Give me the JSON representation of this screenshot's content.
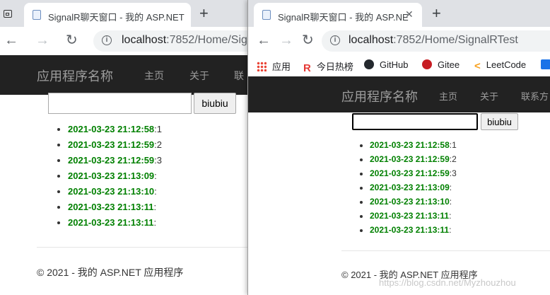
{
  "left": {
    "tab_title": "SignalR聊天窗口 - 我的 ASP.NET",
    "url_host": "localhost",
    "url_path": ":7852/Home/Sig"
  },
  "right": {
    "tab_title": "SignalR聊天窗口 - 我的 ASP.NE",
    "url_host": "localhost",
    "url_path": ":7852/Home/SignalRTest",
    "bookmarks": [
      "应用",
      "今日热榜",
      "GitHub",
      "Gitee",
      "LeetCode"
    ]
  },
  "app": {
    "brand": "应用程序名称",
    "nav_home": "主页",
    "nav_about": "关于",
    "nav_contact_left": "联",
    "nav_contact_right": "联系方",
    "send_label": "biubiu",
    "footer": "© 2021 - 我的 ASP.NET 应用程序"
  },
  "messages": [
    {
      "ts": "2021-03-23 21:12:58",
      "text": ":1"
    },
    {
      "ts": "2021-03-23 21:12:59",
      "text": ":2"
    },
    {
      "ts": "2021-03-23 21:12:59",
      "text": ":3"
    },
    {
      "ts": "2021-03-23 21:13:09",
      "text": ":"
    },
    {
      "ts": "2021-03-23 21:13:10",
      "text": ":"
    },
    {
      "ts": "2021-03-23 21:13:11",
      "text": ":"
    },
    {
      "ts": "2021-03-23 21:13:11",
      "text": ":"
    }
  ],
  "watermark": "https://blog.csdn.net/Myzhouzhou",
  "colors": {
    "navbar": "#222222",
    "timestamp": "#008000",
    "tabstrip": "#dfe1e5"
  }
}
